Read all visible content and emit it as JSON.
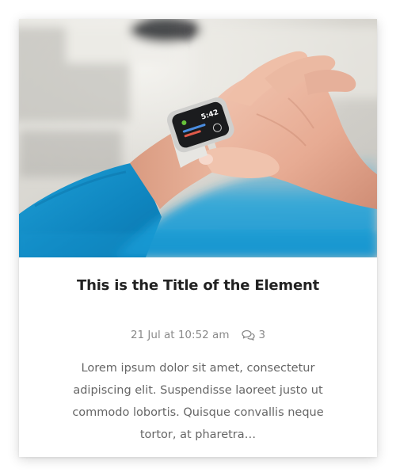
{
  "card": {
    "image": {
      "icon": "smartwatch-photo",
      "watch_time": "5:42"
    },
    "title": "This is the Title of the Element",
    "meta": {
      "date": "21 Jul at 10:52 am",
      "comment_icon": "comments-icon",
      "comment_count": "3"
    },
    "excerpt": "Lorem ipsum dolor sit amet, consectetur adipiscing elit. Suspendisse laoreet justo ut commodo lobortis. Quisque convallis neque tortor, at pharetra…"
  },
  "colors": {
    "title": "#222222",
    "meta": "#8a8a8a",
    "excerpt": "#666666",
    "sleeve_blue": "#1697d0"
  }
}
